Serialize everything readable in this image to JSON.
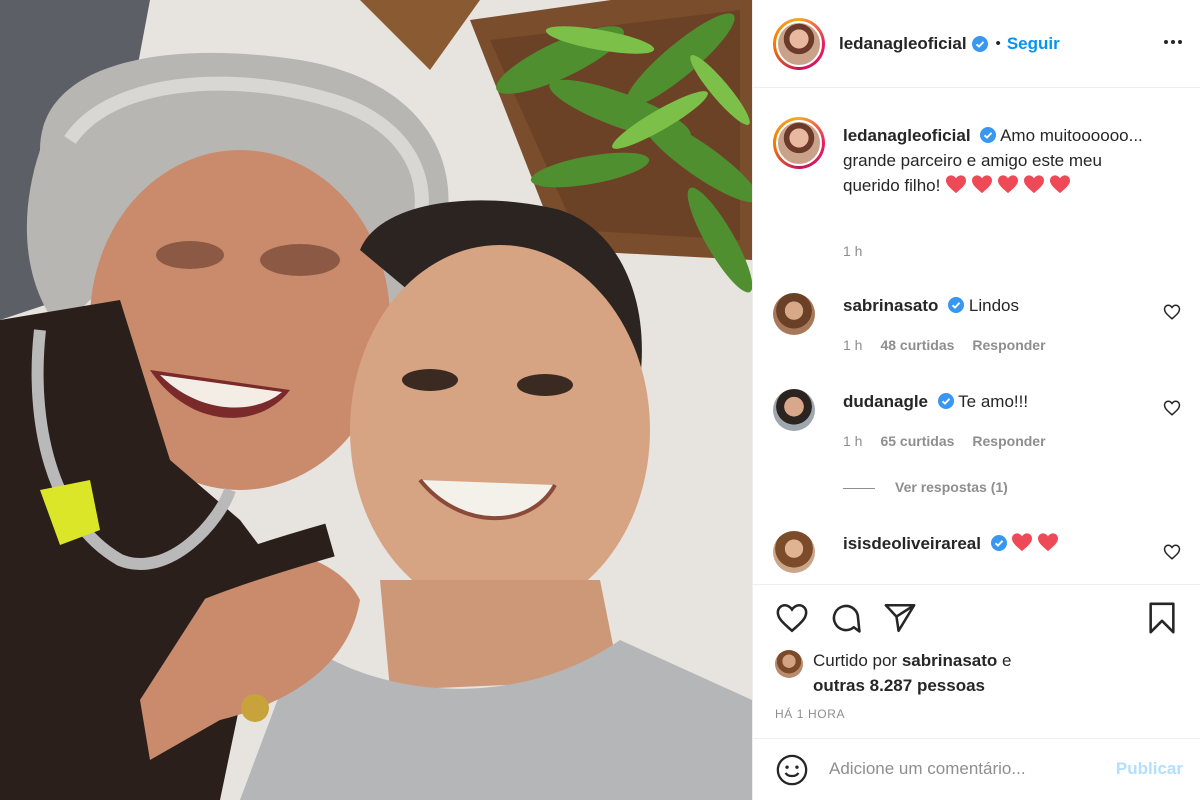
{
  "post": {
    "author": "ledanagleoficial",
    "verified": true,
    "follow_label": "Seguir",
    "separator": "•",
    "caption": {
      "username": "ledanagleoficial",
      "text": "Amo muitoooooo... grande parceiro e amigo este meu querido filho!",
      "hearts": 5,
      "time": "1 h"
    },
    "comments": [
      {
        "username": "sabrinasato",
        "verified": true,
        "text": "Lindos",
        "time": "1 h",
        "likes": "48 curtidas",
        "reply": "Responder"
      },
      {
        "username": "dudanagle",
        "verified": true,
        "text": "Te amo!!!",
        "time": "1 h",
        "likes": "65 curtidas",
        "reply": "Responder",
        "view_replies": "Ver respostas (1)"
      },
      {
        "username": "isisdeoliveirareal",
        "verified": true,
        "text": "",
        "hearts": 2
      }
    ],
    "liked_by": {
      "prefix": "Curtido por",
      "user": "sabrinasato",
      "joiner": "e",
      "others": "outras 8.287 pessoas"
    },
    "time_ago": "HÁ 1 HORA",
    "comment_input": {
      "placeholder": "Adicione um comentário...",
      "submit": "Publicar"
    },
    "icons": {
      "like": "heart-outline-icon",
      "comment": "comment-bubble-icon",
      "share": "paper-plane-icon",
      "save": "bookmark-icon",
      "emoji": "smiley-icon",
      "options": "more-horizontal-icon"
    },
    "colors": {
      "accent": "#0095f6",
      "heart": "#ed4956",
      "muted": "#8e8e8e",
      "verified": "#3897f0"
    }
  }
}
